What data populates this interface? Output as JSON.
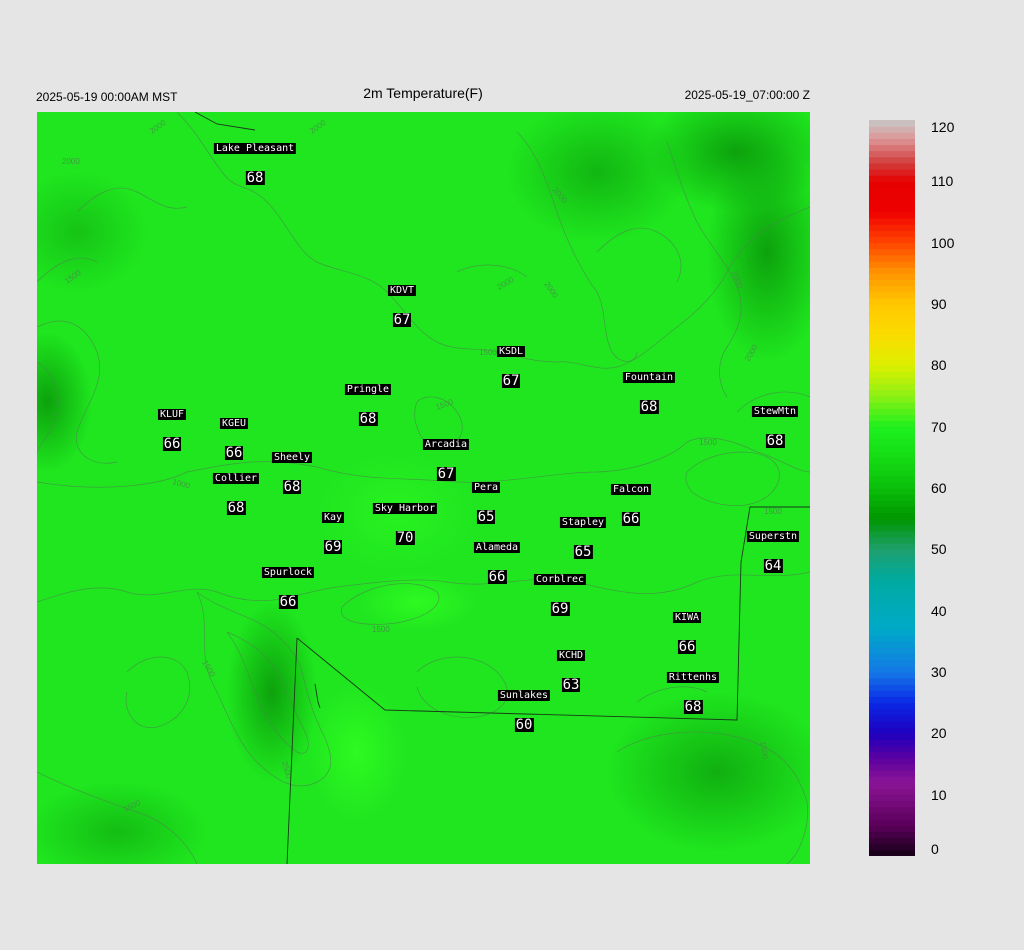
{
  "header": {
    "local_time": "2025-05-19 00:00AM MST",
    "title": "2m Temperature(F)",
    "utc_time": "2025-05-19_07:00:00 Z"
  },
  "colorbar": {
    "min": 0,
    "max": 120,
    "ticks": [
      "0",
      "10",
      "20",
      "30",
      "40",
      "50",
      "60",
      "70",
      "80",
      "90",
      "100",
      "110",
      "120"
    ]
  },
  "contour_labels": [
    "1000",
    "1500",
    "2000",
    "2500"
  ],
  "stations": [
    {
      "name": "Lake Pleasant",
      "value": "68"
    },
    {
      "name": "KDVT",
      "value": "67"
    },
    {
      "name": "KSDL",
      "value": "67"
    },
    {
      "name": "Fountain",
      "value": "68"
    },
    {
      "name": "StewMtn",
      "value": "68"
    },
    {
      "name": "Pringle",
      "value": "68"
    },
    {
      "name": "KLUF",
      "value": "66"
    },
    {
      "name": "KGEU",
      "value": "66"
    },
    {
      "name": "Arcadia",
      "value": "67"
    },
    {
      "name": "Sheely",
      "value": "68"
    },
    {
      "name": "Collier",
      "value": "68"
    },
    {
      "name": "Pera",
      "value": "65"
    },
    {
      "name": "Falcon",
      "value": "66"
    },
    {
      "name": "Kay",
      "value": "69"
    },
    {
      "name": "Sky Harbor",
      "value": "70"
    },
    {
      "name": "Stapley",
      "value": "65"
    },
    {
      "name": "Superstn",
      "value": "64"
    },
    {
      "name": "Alameda",
      "value": "66"
    },
    {
      "name": "Spurlock",
      "value": "66"
    },
    {
      "name": "Corblrec",
      "value": "69"
    },
    {
      "name": "KIWA",
      "value": "66"
    },
    {
      "name": "KCHD",
      "value": "63"
    },
    {
      "name": "Rittenhs",
      "value": "68"
    },
    {
      "name": "Sunlakes",
      "value": "60"
    }
  ]
}
